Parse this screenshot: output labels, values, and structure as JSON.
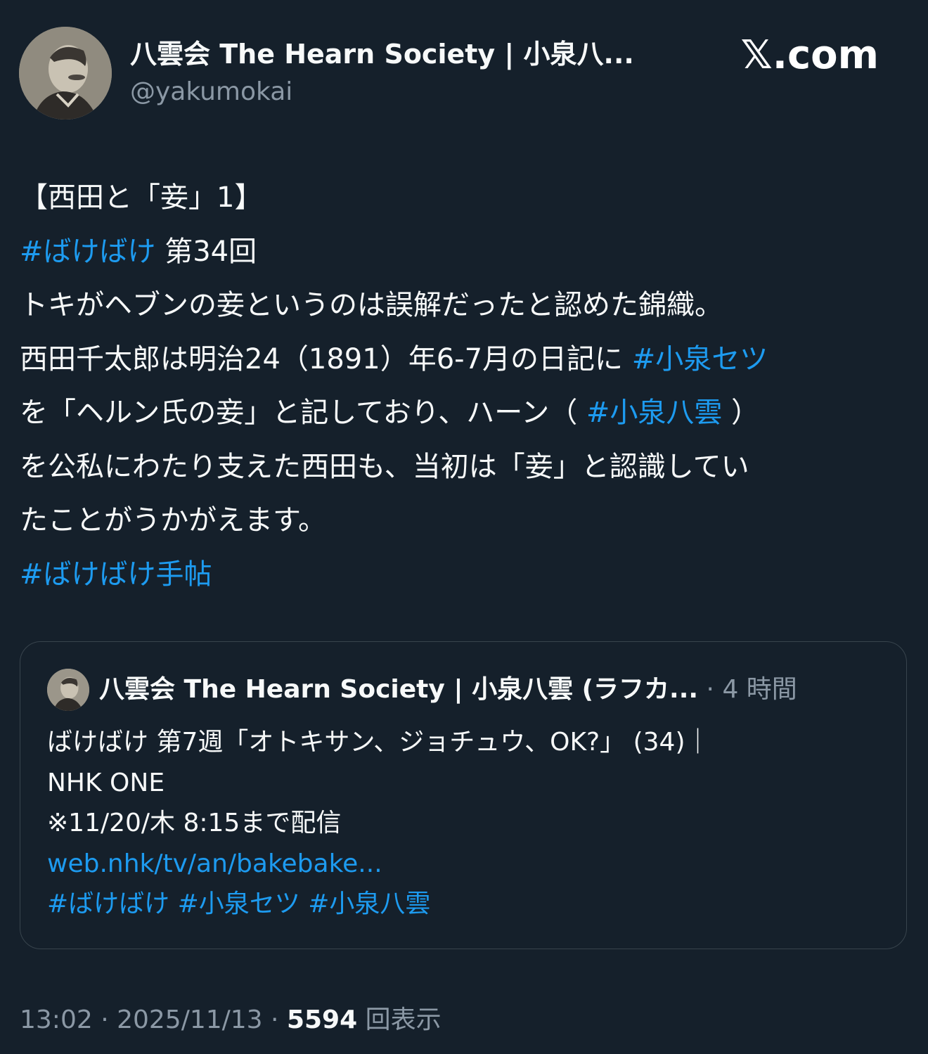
{
  "author": {
    "display_name": "八雲会 The Hearn Society | 小泉八...",
    "handle": "@yakumokai"
  },
  "brand": "𝕏.com",
  "tweet": {
    "line1": "【西田と「妾」1】",
    "line2_tag": "#ばけばけ",
    "line2_text": " 第34回",
    "line3": "トキがヘブンの妾というのは誤解だったと認めた錦織。",
    "line4_text": "西田千太郎は明治24（1891）年6-7月の日記に ",
    "line4_tag": "#小泉セツ",
    "line5_text_a": "を「ヘルン氏の妾」と記しており、ハーン（ ",
    "line5_tag": "#小泉八雲",
    "line5_text_b": " ）",
    "line6": "を公私にわたり支えた西田も、当初は「妾」と認識してい",
    "line7": "たことがうかがえます。",
    "line8_tag": "#ばけばけ手帖"
  },
  "quoted": {
    "name": "八雲会 The Hearn Society | 小泉八雲 (ラフカ...",
    "separator": " · ",
    "time": "4 時間",
    "line1": "ばけばけ 第7週「オトキサン、ジョチュウ、OK?」 (34)｜",
    "line2": "NHK ONE",
    "line3": "※11/20/木 8:15まで配信",
    "link": "web.nhk/tv/an/bakebake...",
    "tags": [
      "#ばけばけ",
      "#小泉セツ",
      "#小泉八雲"
    ]
  },
  "footer": {
    "time": "13:02",
    "date": "2025/11/13",
    "sep": " · ",
    "views": "5594",
    "views_label": " 回表示"
  },
  "colors": {
    "background": "#15202b",
    "text": "#f7f9f9",
    "secondary": "#8b98a5",
    "link": "#1d9bf0",
    "border": "#38444d"
  }
}
